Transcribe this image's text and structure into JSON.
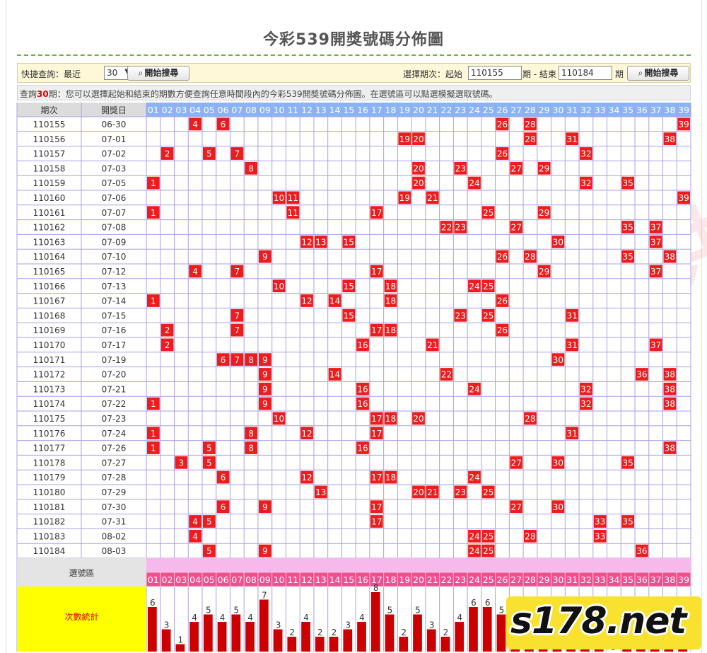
{
  "title": "今彩539開獎號碼分佈圖",
  "quick": {
    "label": "快捷查詢：最近",
    "select_value": "30",
    "suffix": "期",
    "button": "開始搜尋"
  },
  "range": {
    "label": "選擇期次：起始",
    "start": "110155",
    "mid": "期 - 結束",
    "end": "110184",
    "suffix": "期",
    "button": "開始搜尋"
  },
  "info": {
    "prefix": "查詢",
    "count": "30",
    "text": "期：您可以選擇起始和結束的期數方便查詢任意時間段內的今彩539開獎號碼分佈圖。在選號區可以點選模擬選取號碼。"
  },
  "columns": {
    "period": "期次",
    "date": "開獎日"
  },
  "numbers": [
    "01",
    "02",
    "03",
    "04",
    "05",
    "06",
    "07",
    "08",
    "09",
    "10",
    "11",
    "12",
    "13",
    "14",
    "15",
    "16",
    "17",
    "18",
    "19",
    "20",
    "21",
    "22",
    "23",
    "24",
    "25",
    "26",
    "27",
    "28",
    "29",
    "30",
    "31",
    "32",
    "33",
    "34",
    "35",
    "36",
    "37",
    "38",
    "39"
  ],
  "draws": [
    {
      "period": "110155",
      "date": "06-30",
      "nums": [
        4,
        6,
        26,
        28,
        39
      ]
    },
    {
      "period": "110156",
      "date": "07-01",
      "nums": [
        19,
        20,
        28,
        31,
        38
      ]
    },
    {
      "period": "110157",
      "date": "07-02",
      "nums": [
        2,
        5,
        7,
        26,
        32
      ]
    },
    {
      "period": "110158",
      "date": "07-03",
      "nums": [
        8,
        20,
        23,
        27,
        29
      ]
    },
    {
      "period": "110159",
      "date": "07-05",
      "nums": [
        1,
        20,
        24,
        32,
        35
      ]
    },
    {
      "period": "110160",
      "date": "07-06",
      "nums": [
        10,
        11,
        19,
        21,
        39
      ]
    },
    {
      "period": "110161",
      "date": "07-07",
      "nums": [
        1,
        11,
        17,
        25,
        29
      ]
    },
    {
      "period": "110162",
      "date": "07-08",
      "nums": [
        22,
        23,
        27,
        35,
        37
      ]
    },
    {
      "period": "110163",
      "date": "07-09",
      "nums": [
        12,
        13,
        15,
        30,
        37
      ]
    },
    {
      "period": "110164",
      "date": "07-10",
      "nums": [
        9,
        26,
        28,
        35,
        38
      ]
    },
    {
      "period": "110165",
      "date": "07-12",
      "nums": [
        4,
        7,
        17,
        29,
        37
      ]
    },
    {
      "period": "110166",
      "date": "07-13",
      "nums": [
        10,
        15,
        18,
        24,
        25
      ]
    },
    {
      "period": "110167",
      "date": "07-14",
      "nums": [
        1,
        12,
        14,
        18,
        26
      ]
    },
    {
      "period": "110168",
      "date": "07-15",
      "nums": [
        7,
        15,
        23,
        25,
        31
      ]
    },
    {
      "period": "110169",
      "date": "07-16",
      "nums": [
        2,
        7,
        17,
        18,
        26
      ]
    },
    {
      "period": "110170",
      "date": "07-17",
      "nums": [
        2,
        16,
        21,
        31,
        37
      ]
    },
    {
      "period": "110171",
      "date": "07-19",
      "nums": [
        6,
        7,
        8,
        9,
        30
      ]
    },
    {
      "period": "110172",
      "date": "07-20",
      "nums": [
        9,
        14,
        22,
        36,
        38
      ]
    },
    {
      "period": "110173",
      "date": "07-21",
      "nums": [
        9,
        16,
        24,
        32,
        38
      ]
    },
    {
      "period": "110174",
      "date": "07-22",
      "nums": [
        1,
        9,
        16,
        32,
        38
      ]
    },
    {
      "period": "110175",
      "date": "07-23",
      "nums": [
        10,
        17,
        18,
        20,
        28
      ]
    },
    {
      "period": "110176",
      "date": "07-24",
      "nums": [
        1,
        8,
        12,
        17,
        31
      ]
    },
    {
      "period": "110177",
      "date": "07-26",
      "nums": [
        1,
        5,
        8,
        16,
        38
      ]
    },
    {
      "period": "110178",
      "date": "07-27",
      "nums": [
        3,
        5,
        27,
        30,
        35
      ]
    },
    {
      "period": "110179",
      "date": "07-28",
      "nums": [
        6,
        12,
        17,
        18,
        24
      ]
    },
    {
      "period": "110180",
      "date": "07-29",
      "nums": [
        13,
        20,
        21,
        23,
        25
      ]
    },
    {
      "period": "110181",
      "date": "07-30",
      "nums": [
        6,
        9,
        17,
        27,
        30
      ]
    },
    {
      "period": "110182",
      "date": "07-31",
      "nums": [
        4,
        5,
        17,
        33,
        35
      ]
    },
    {
      "period": "110183",
      "date": "08-02",
      "nums": [
        4,
        24,
        25,
        28,
        33
      ]
    },
    {
      "period": "110184",
      "date": "08-03",
      "nums": [
        5,
        9,
        24,
        25,
        36
      ]
    }
  ],
  "pick_area_label": "選號區",
  "stats": {
    "label": "次數統計",
    "counts": [
      6,
      3,
      1,
      4,
      5,
      4,
      5,
      4,
      7,
      3,
      2,
      4,
      2,
      2,
      3,
      4,
      8,
      5,
      2,
      5,
      3,
      2,
      4,
      6,
      6,
      5,
      4,
      4,
      3,
      4,
      3,
      4,
      2,
      0,
      4,
      2,
      3,
      5,
      2
    ]
  },
  "watermark": "太陽城娛樂城提供",
  "logo": "s178.net",
  "colors": {
    "ball": "#ee1c1c",
    "header_blue": "#8ab4f8",
    "pick_pink": "#f7b9ec",
    "pink_row": "#ee4f8e",
    "yellow": "#ffff00",
    "bar": "#cc0000",
    "grid_line": "#a9a0e8"
  }
}
